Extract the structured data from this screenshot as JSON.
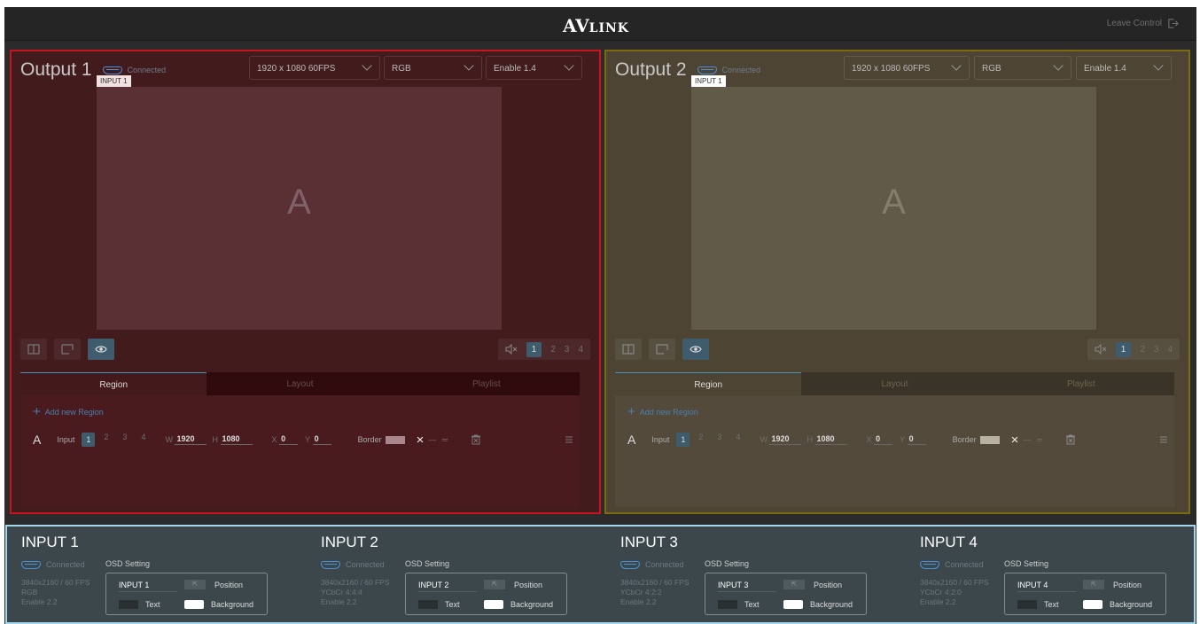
{
  "header": {
    "logo_main": "AV",
    "logo_rest": "LINK",
    "leave_label": "Leave Control"
  },
  "outputs": [
    {
      "title": "Output 1",
      "status": "Connected",
      "resolution": "1920 x 1080 60FPS",
      "color_space": "RGB",
      "hdcp": "Enable 1.4",
      "canvas_tag": "INPUT 1",
      "canvas_letter": "A",
      "pages": [
        "1",
        "2",
        "3",
        "4"
      ],
      "tabs": [
        "Region",
        "Layout",
        "Playlist"
      ],
      "add_region": "Add new Region",
      "region": {
        "letter": "A",
        "input_label": "Input",
        "inputs": [
          "1",
          "2",
          "3",
          "4"
        ],
        "w_label": "W",
        "w": "1920",
        "h_label": "H",
        "h": "1080",
        "x_label": "X",
        "x": "0",
        "y_label": "Y",
        "y": "0",
        "border_label": "Border"
      }
    },
    {
      "title": "Output 2",
      "status": "Connected",
      "resolution": "1920 x 1080 60FPS",
      "color_space": "RGB",
      "hdcp": "Enable 1.4",
      "canvas_tag": "INPUT 1",
      "canvas_letter": "A",
      "pages": [
        "1",
        "2",
        "3",
        "4"
      ],
      "tabs": [
        "Region",
        "Layout",
        "Playlist"
      ],
      "add_region": "Add new Region",
      "region": {
        "letter": "A",
        "input_label": "Input",
        "inputs": [
          "1",
          "2",
          "3",
          "4"
        ],
        "w_label": "W",
        "w": "1920",
        "h_label": "H",
        "h": "1080",
        "x_label": "X",
        "x": "0",
        "y_label": "Y",
        "y": "0",
        "border_label": "Border"
      }
    }
  ],
  "inputs": [
    {
      "title": "INPUT 1",
      "status": "Connected",
      "res": "3840x2160 / 60 FPS",
      "color": "RGB",
      "hdcp": "Enable 2.2",
      "osd_label": "OSD Setting",
      "osd_name": "INPUT 1",
      "position": "Position",
      "text": "Text",
      "background": "Background"
    },
    {
      "title": "INPUT 2",
      "status": "Connected",
      "res": "3840x2160 / 60 FPS",
      "color": "YCbCr 4:4:4",
      "hdcp": "Enable 2.2",
      "osd_label": "OSD Setting",
      "osd_name": "INPUT 2",
      "position": "Position",
      "text": "Text",
      "background": "Background"
    },
    {
      "title": "INPUT 3",
      "status": "Connected",
      "res": "3840x2160 / 60 FPS",
      "color": "YCbCr 4:2:2",
      "hdcp": "Enable 2.2",
      "osd_label": "OSD Setting",
      "osd_name": "INPUT 3",
      "position": "Position",
      "text": "Text",
      "background": "Background"
    },
    {
      "title": "INPUT 4",
      "status": "Connected",
      "res": "3840x2160 / 60 FPS",
      "color": "YCbCr 4:2:0",
      "hdcp": "Enable 2.2",
      "osd_label": "OSD Setting",
      "osd_name": "INPUT 4",
      "position": "Position",
      "text": "Text",
      "background": "Background"
    }
  ],
  "colors": {
    "output1_border": "#c8141e",
    "output2_border": "#7c6a10",
    "accent": "#4a90d9",
    "inputs_border": "#a4d6ee"
  }
}
